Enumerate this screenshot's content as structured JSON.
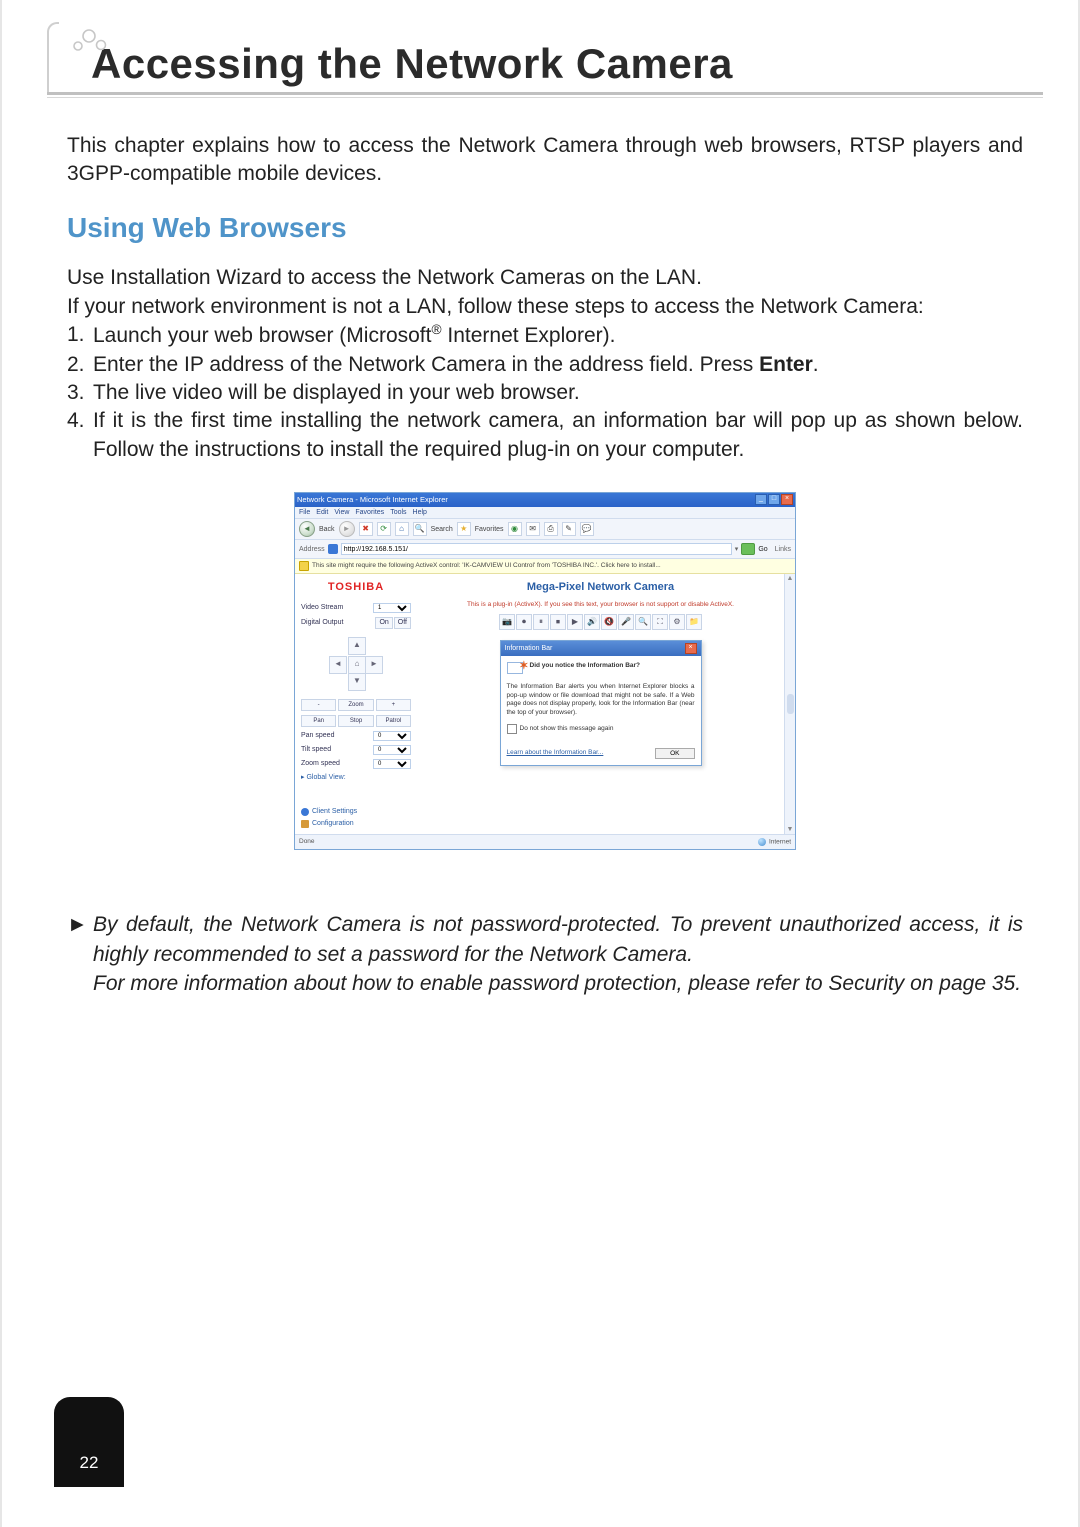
{
  "chapter_title": "Accessing the Network Camera",
  "intro_para": "This chapter explains how to access the Network Camera through web browsers, RTSP players and 3GPP-compatible mobile devices.",
  "section1_heading": "Using Web Browsers",
  "pre_steps_line1": "Use Installation Wizard to access the Network Cameras on the LAN.",
  "pre_steps_line2": "If your network environment is not a LAN, follow these steps to access the Network Camera:",
  "steps": {
    "s1": {
      "num": "1.",
      "text_a": "Launch your web browser (Microsoft",
      "sup": "®",
      "text_b": " Internet Explorer)."
    },
    "s2": {
      "num": "2.",
      "text_a": "Enter the IP address of the Network Camera in the address field. Press ",
      "bold": "Enter",
      "text_b": "."
    },
    "s3": {
      "num": "3.",
      "text": "The live video will be displayed in your web browser."
    },
    "s4": {
      "num": "4.",
      "text": "If it is the first time installing the network camera, an information bar will pop up as shown below. Follow the instructions to install the required plug-in on your computer."
    }
  },
  "ie": {
    "title": "Network Camera - Microsoft Internet Explorer",
    "menus": [
      "File",
      "Edit",
      "View",
      "Favorites",
      "Tools",
      "Help"
    ],
    "toolbar": {
      "back": "Back",
      "search": "Search",
      "favorites": "Favorites"
    },
    "addr_label": "Address",
    "addr_value": "http://192.168.5.151/",
    "go": "Go",
    "links": "Links",
    "infobar": "This site might require the following ActiveX control: 'IK-CAMVIEW UI Control' from 'TOSHIBA INC.'. Click here to install...",
    "status_done": "Done",
    "status_zone": "Internet"
  },
  "sidebar": {
    "logo": "TOSHIBA",
    "video_stream_label": "Video Stream",
    "video_stream_value": "1",
    "digital_output_label": "Digital Output",
    "digital_output_on": "On",
    "digital_output_off": "Off",
    "zoom_row": [
      "-",
      "Zoom",
      "+"
    ],
    "ptz_row": [
      "Pan",
      "Stop",
      "Patrol"
    ],
    "pan_speed_label": "Pan speed",
    "pan_speed_value": "0",
    "tilt_speed_label": "Tilt speed",
    "tilt_speed_value": "0",
    "zoom_speed_label": "Zoom speed",
    "zoom_speed_value": "0",
    "global_view": "Global View:",
    "client_settings": "Client Settings",
    "configuration": "Configuration"
  },
  "main_panel": {
    "title": "Mega-Pixel Network Camera",
    "plugin_note": "This is a plug-in (ActiveX). If you see this text, your browser is not support or disable ActiveX."
  },
  "dialog": {
    "title": "Information Bar",
    "heading": "Did you notice the Information Bar?",
    "body": "The Information Bar alerts you when Internet Explorer blocks a pop-up window or file download that might not be safe. If a Web page does not display properly, look for the Information Bar (near the top of your browser).",
    "checkbox": "Do not show this message again",
    "learn_link": "Learn about the Information Bar...",
    "ok": "OK"
  },
  "note": {
    "arrow": "►",
    "line1": "By default, the Network Camera is not password-protected. To prevent unauthorized access, it is highly recommended to set a password for the Network Camera.",
    "line2": "For more information about how to enable password protection, please refer to Security on page 35."
  },
  "page_number": "22"
}
